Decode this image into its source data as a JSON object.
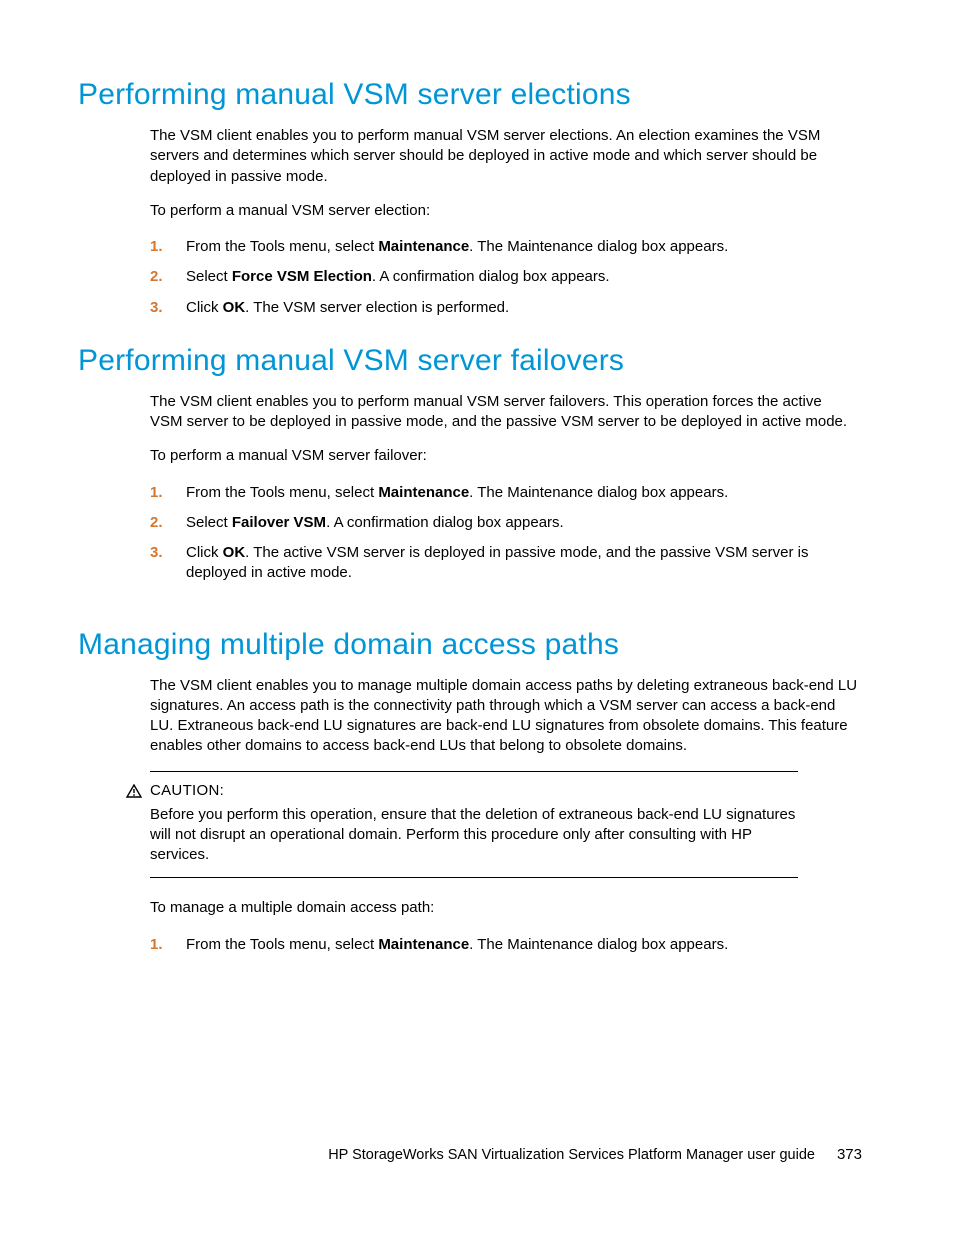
{
  "sections": [
    {
      "title": "Performing manual VSM server elections",
      "intro": "The VSM client enables you to perform manual VSM server elections. An election examines the VSM servers and determines which server should be deployed in active mode and which server should be deployed in passive mode.",
      "lead": "To perform a manual VSM server election:",
      "steps": [
        {
          "n": "1.",
          "pre": "From the Tools menu, select ",
          "bold": "Maintenance",
          "post": ". The Maintenance dialog box appears."
        },
        {
          "n": "2.",
          "pre": "Select ",
          "bold": "Force VSM Election",
          "post": ". A confirmation dialog box appears."
        },
        {
          "n": "3.",
          "pre": "Click ",
          "bold": "OK",
          "post": ". The VSM server election is performed."
        }
      ]
    },
    {
      "title": "Performing manual VSM server failovers",
      "intro": "The VSM client enables you to perform manual VSM server failovers. This operation forces the active VSM server to be deployed in passive mode, and the passive VSM server to be deployed in active mode.",
      "lead": "To perform a manual VSM server failover:",
      "steps": [
        {
          "n": "1.",
          "pre": "From the Tools menu, select ",
          "bold": "Maintenance",
          "post": ". The Maintenance dialog box appears."
        },
        {
          "n": "2.",
          "pre": "Select ",
          "bold": "Failover VSM",
          "post": ". A confirmation dialog box appears."
        },
        {
          "n": "3.",
          "pre": "Click ",
          "bold": "OK",
          "post": ". The active VSM server is deployed in passive mode, and the passive VSM server is deployed in active mode."
        }
      ]
    },
    {
      "title": "Managing multiple domain access paths",
      "intro": "The VSM client enables you to manage multiple domain access paths by deleting extraneous back-end LU signatures. An access path is the connectivity path through which a VSM server can access a back-end LU. Extraneous back-end LU signatures are back-end LU signatures from obsolete domains. This feature enables other domains to access back-end LUs that belong to obsolete domains.",
      "caution": {
        "label": "CAUTION:",
        "text": "Before you perform this operation, ensure that the deletion of extraneous back-end LU signatures will not disrupt an operational domain. Perform this procedure only after consulting with HP services."
      },
      "lead": "To manage a multiple domain access path:",
      "steps": [
        {
          "n": "1.",
          "pre": "From the Tools menu, select ",
          "bold": "Maintenance",
          "post": ". The Maintenance dialog box appears."
        }
      ]
    }
  ],
  "footer": {
    "title": "HP StorageWorks SAN Virtualization Services Platform Manager user guide",
    "page": "373"
  }
}
